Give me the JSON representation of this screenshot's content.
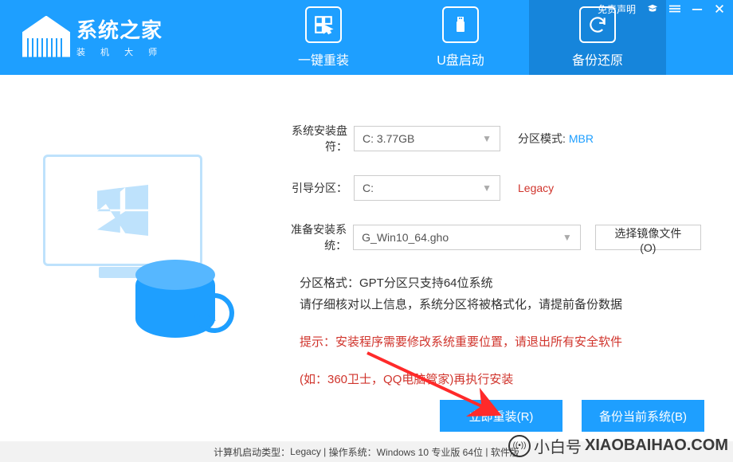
{
  "titlebar": {
    "disclaimer": "免责声明"
  },
  "header": {
    "brand_big": "系统之家",
    "brand_small": "装 机 大 师",
    "tabs": [
      {
        "label": "一键重装",
        "icon": "window-cursor-icon"
      },
      {
        "label": "U盘启动",
        "icon": "usb-icon"
      },
      {
        "label": "备份还原",
        "icon": "refresh-icon"
      }
    ]
  },
  "form": {
    "drive": {
      "label": "系统安装盘符：",
      "value": "C: 3.77GB",
      "mode_label": "分区模式:",
      "mode_value": "MBR"
    },
    "boot": {
      "label": "引导分区：",
      "value": "C:",
      "mode_value": "Legacy"
    },
    "image": {
      "label": "准备安装系统：",
      "value": "G_Win10_64.gho",
      "choose_btn": "选择镜像文件(O)"
    }
  },
  "notes": {
    "line1": "分区格式：GPT分区只支持64位系统",
    "line2": "请仔细核对以上信息，系统分区将被格式化，请提前备份数据",
    "warn1": "提示：安装程序需要修改系统重要位置，请退出所有安全软件",
    "warn2": "(如：360卫士，QQ电脑管家)再执行安装"
  },
  "buttons": {
    "install": "立即重装(R)",
    "backup": "备份当前系统(B)"
  },
  "status": {
    "boot_type_label": "计算机启动类型：",
    "boot_type_value": "Legacy",
    "os_label": "操作系统：",
    "os_value": "Windows 10 专业版 64位",
    "soft_label": "软件版"
  },
  "watermark": {
    "cn": "小白号",
    "domain": "XIAOBAIHAO.COM"
  }
}
